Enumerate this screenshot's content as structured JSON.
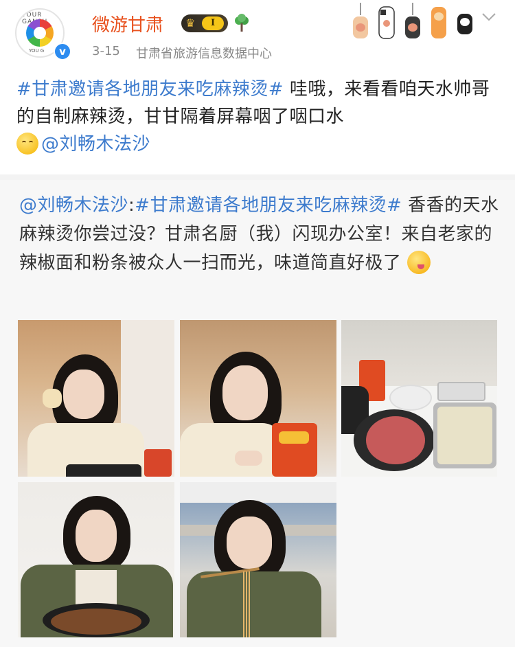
{
  "header": {
    "avatar_text_top": "TOUR GANSU",
    "avatar_text_bottom": "YOU G",
    "verified_mark": "v",
    "username": "微游甘肃",
    "level": "I",
    "time": "3-15",
    "source": "甘肃省旅游信息数据中心",
    "icons": [
      "crown-icon",
      "tree-icon",
      "paw-icons",
      "chevron-down-icon"
    ]
  },
  "post": {
    "hashtag": "#甘肃邀请各地朋友来吃麻辣烫#",
    "text": " 哇哦，来看看咱天水帅哥的自制麻辣烫，甘甘隔着屏幕咽了咽口水",
    "mention": "@刘畅木法沙"
  },
  "repost": {
    "mention": "@刘畅木法沙",
    "colon": ":",
    "hashtag": "#甘肃邀请各地朋友来吃麻辣烫#",
    "text": " 香香的天水麻辣烫你尝过没？甘肃名厨（我）闪现办公室！来自老家的辣椒面和粉条被众人一扫而光，味道简直好极了"
  },
  "colors": {
    "username": "#e8521f",
    "link": "#3d7bcd",
    "meta": "#888888",
    "repost_bg": "#f7f7f7"
  }
}
